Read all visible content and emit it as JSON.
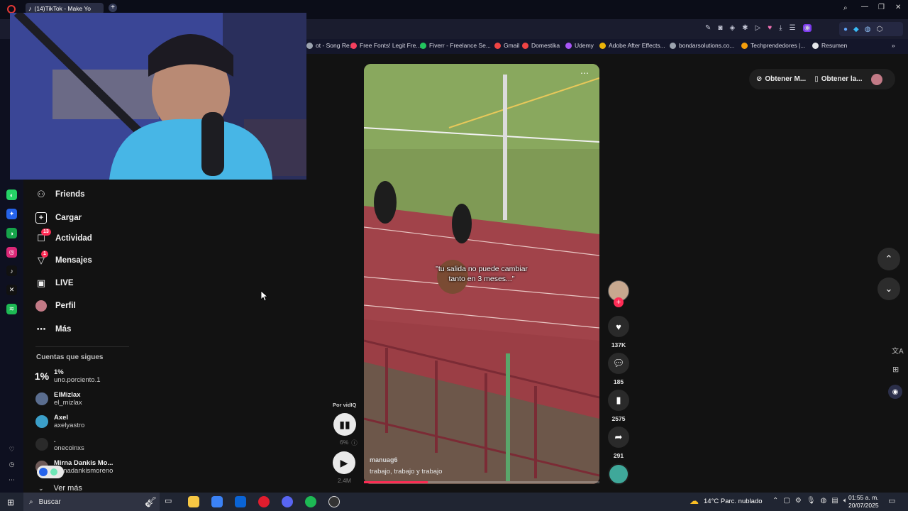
{
  "browser": {
    "tab_title": "(14)TikTok - Make Yo",
    "bookmarks": [
      {
        "label": "ot - Song Re...",
        "color": "#9ca3af"
      },
      {
        "label": "Free Fonts! Legit Fre...",
        "color": "#f43f5e"
      },
      {
        "label": "Fiverr - Freelance Se...",
        "color": "#22c55e"
      },
      {
        "label": "Gmail",
        "color": "#ef4444"
      },
      {
        "label": "Domestika",
        "color": "#ef4444"
      },
      {
        "label": "Udemy",
        "color": "#a855f7"
      },
      {
        "label": "Adobe After Effects...",
        "color": "#eab308"
      },
      {
        "label": "bondarsolutions.co...",
        "color": "#9ca3af"
      },
      {
        "label": "Techprendedores |...",
        "color": "#f59e0b"
      },
      {
        "label": "Resumen",
        "color": "#e5e7eb"
      }
    ]
  },
  "sidebar": {
    "items": [
      {
        "label": "Friends",
        "icon": "friends-icon",
        "badge": ""
      },
      {
        "label": "Cargar",
        "icon": "upload-icon",
        "badge": ""
      },
      {
        "label": "Actividad",
        "icon": "activity-icon",
        "badge": "13"
      },
      {
        "label": "Mensajes",
        "icon": "messages-icon",
        "badge": "1"
      },
      {
        "label": "LIVE",
        "icon": "live-icon",
        "badge": ""
      },
      {
        "label": "Perfil",
        "icon": "profile-avatar",
        "badge": ""
      },
      {
        "label": "Más",
        "icon": "more-icon",
        "badge": ""
      }
    ],
    "following_title": "Cuentas que sigues",
    "following": [
      {
        "name": "1%",
        "user": "uno.porciento.1"
      },
      {
        "name": "ElMizlax",
        "user": "el_mizlax"
      },
      {
        "name": "Axel",
        "user": "axelyastro"
      },
      {
        "name": ".",
        "user": "onecoinxs"
      },
      {
        "name": "Mirna Dankis Mo...",
        "user": "mirnadankismoreno"
      }
    ],
    "see_more": "Ver más"
  },
  "video": {
    "caption_line1": "\"tu salida no puede cambiar",
    "caption_line2": "tanto en 3 meses...\"",
    "author": "manuag6",
    "description": "trabajo, trabajo y trabajo",
    "progress": 0.27
  },
  "actions": {
    "likes": "137K",
    "comments": "185",
    "saves": "2575",
    "shares": "291"
  },
  "vidiq": {
    "label": "Por vidIQ",
    "percent": "6%",
    "views": "2.4M"
  },
  "top_right": {
    "btn1": "Obtener M...",
    "btn2": "Obtener la..."
  },
  "taskbar": {
    "search_placeholder": "Buscar",
    "weather": "14°C  Parc. nublado",
    "time": "01:55 a. m.",
    "date": "20/07/2025"
  }
}
